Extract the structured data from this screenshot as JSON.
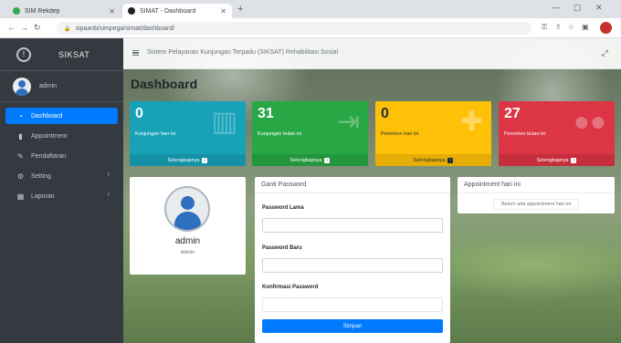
{
  "browser": {
    "tabs": [
      {
        "title": "SIM Rekdep",
        "active": false
      },
      {
        "title": "SIMAT - Dashboard",
        "active": true
      }
    ],
    "url": "sipaanb/simpega/simat/dashboard/"
  },
  "colors": {
    "sidebar_bg": "#343a40",
    "accent": "#007bff",
    "info": "#17a2b8",
    "success": "#28a745",
    "warning": "#ffc107",
    "danger": "#dc3545"
  },
  "sidebar": {
    "brand": "SIKSAT",
    "user": "admin",
    "items": [
      {
        "label": "Dashboard",
        "icon": "dashboard-icon",
        "active": true,
        "has_arrow": false
      },
      {
        "label": "Appointment",
        "icon": "document-icon",
        "active": false,
        "has_arrow": false
      },
      {
        "label": "Pendaftaran",
        "icon": "edit-icon",
        "active": false,
        "has_arrow": false
      },
      {
        "label": "Setting",
        "icon": "settings-icon",
        "active": false,
        "has_arrow": true
      },
      {
        "label": "Laporan",
        "icon": "report-icon",
        "active": false,
        "has_arrow": true
      }
    ]
  },
  "topbar": {
    "text": "Sistem Pelayanan Kunjungan Terpadu (SIKSAT) Rehabilitasi Sosial"
  },
  "page": {
    "title": "Dashboard"
  },
  "boxes": [
    {
      "value": "0",
      "label": "Kunjungan hari ini",
      "footer": "Selengkapnya",
      "color": "#17a2b8",
      "icon": "building-icon"
    },
    {
      "value": "31",
      "label": "Kunjungan bulan ini",
      "footer": "Selengkapnya",
      "color": "#28a745",
      "icon": "sign-in-icon"
    },
    {
      "value": "0",
      "label": "Pemohon hari ini",
      "footer": "Selengkapnya",
      "color": "#ffc107",
      "icon": "user-plus-icon"
    },
    {
      "value": "27",
      "label": "Pemohon bulan ini",
      "footer": "Selengkapnya",
      "color": "#dc3545",
      "icon": "users-icon"
    }
  ],
  "profile": {
    "name": "admin",
    "role": "Admin"
  },
  "password_form": {
    "header": "Ganti Password",
    "fields": [
      {
        "label": "Password Lama",
        "value": ""
      },
      {
        "label": "Password Baru",
        "value": ""
      },
      {
        "label": "Konfirmasi Password",
        "value": ""
      }
    ],
    "submit": "Simpan"
  },
  "appointment": {
    "header": "Appointment hari ini",
    "empty_text": "Belum ada appointment hari ini"
  }
}
